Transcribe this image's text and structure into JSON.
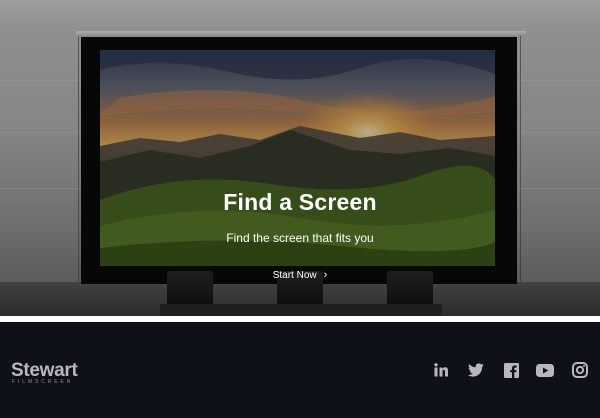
{
  "hero": {
    "title": "Find a Screen",
    "subtitle": "Find the screen that fits you",
    "cta_label": "Start Now",
    "cta_icon": "chevron-right-icon",
    "cta_chevron": "›"
  },
  "footer": {
    "logo_text": "Stewart",
    "logo_subtext": "FILMSCREEN",
    "social": [
      {
        "name": "linkedin-icon"
      },
      {
        "name": "twitter-icon"
      },
      {
        "name": "facebook-icon"
      },
      {
        "name": "youtube-icon"
      },
      {
        "name": "instagram-icon"
      }
    ]
  },
  "colors": {
    "footer_bg": "#0e1117",
    "footer_icon": "#b6b8bb",
    "text_light": "#ffffff"
  }
}
